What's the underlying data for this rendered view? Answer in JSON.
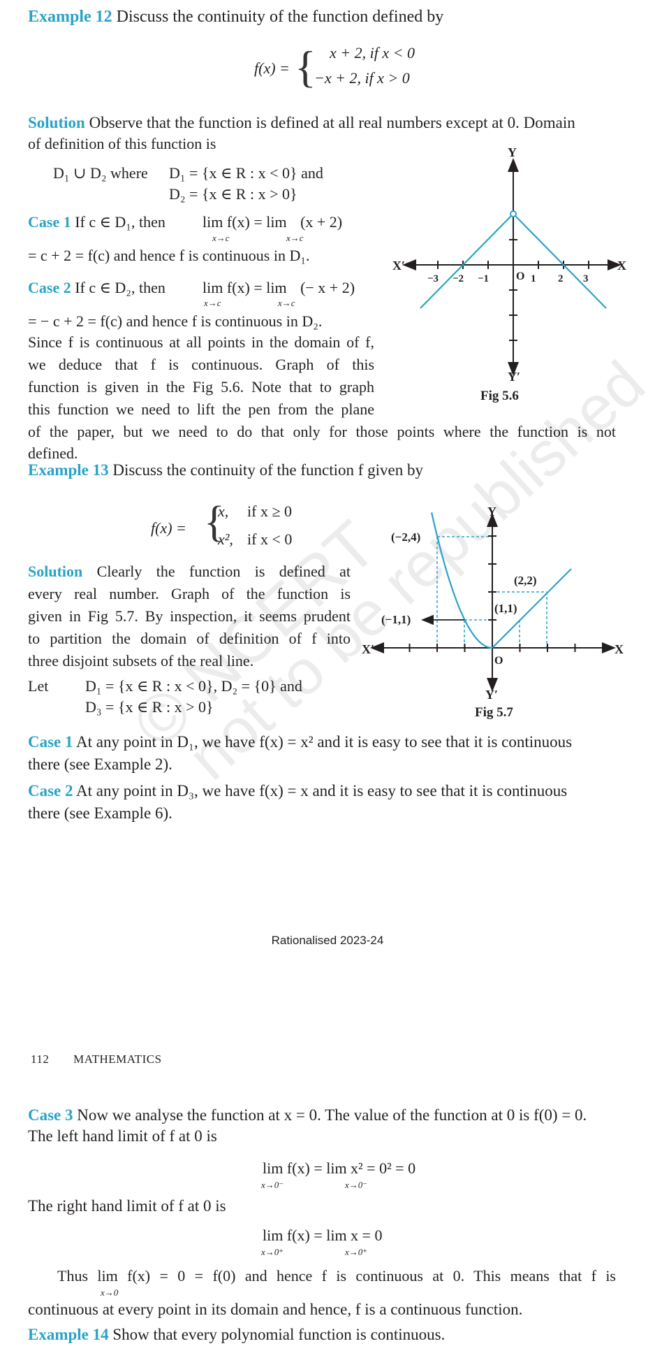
{
  "page": {
    "watermark_line1": "© NCERT",
    "watermark_line2": "not to be republished",
    "footer_center": "Rationalised 2023-24",
    "running_header_page_number": "112",
    "running_header_title": "MATHEMATICS",
    "accent_color": "#2aa3c6",
    "curve_color": "#2aa3c6"
  },
  "example12": {
    "label": "Example 12",
    "prompt": "Discuss the continuity of the function defined by",
    "fx": "f(x) =",
    "case_top": "x + 2, if x < 0",
    "case_bottom": "−x + 2, if x > 0",
    "solution_label": "Solution",
    "solution_line1": "Observe that the function is defined at all real numbers except at 0. Domain",
    "solution_line2": "of definition of this function is",
    "domain_line1_a": "D",
    "domain_union": "D₁ ∪ D₂ where",
    "domain_d1": "D₁ = {x ∈ R : x < 0} and",
    "domain_d2": "D₂ = {x ∈ R : x > 0}",
    "case1_label": "Case 1",
    "case1_text": "If c ∈ D₁, then",
    "case1_lim_left": "lim f(x) = lim",
    "case1_lim_sub": "x→c",
    "case1_expr": "(x + 2)",
    "case1_cont": "= c + 2 = f(c) and hence f is continuous in D₁.",
    "case2_label": "Case 2",
    "case2_text": "If c ∈ D₂, then",
    "case2_expr": "(− x + 2)",
    "case2_cont": "= − c + 2 = f(c) and hence f is continuous in D₂.",
    "para_lines": [
      "Since f is continuous at all points in the domain of f,",
      "we deduce that f is continuous. Graph of this",
      "function is given in the Fig 5.6. Note that to graph",
      "this function we need to lift the pen from the plane"
    ],
    "para_full_line": "of the paper, but we need to do that only for those points where the function is not",
    "para_last": "defined."
  },
  "fig56": {
    "caption": "Fig 5.6",
    "y_label": "Y",
    "y_neg_label": "Y′",
    "x_label": "X",
    "x_neg_label": "X′",
    "origin_label": "O",
    "x_ticks": [
      "−3",
      "−2",
      "−1",
      "1",
      "2",
      "3"
    ]
  },
  "example13": {
    "label": "Example 13",
    "prompt": "Discuss the continuity of the function f given by",
    "fx": "f(x) =",
    "case_top_val": "x,",
    "case_top_cond": "if x ≥ 0",
    "case_bottom_val": "x²,",
    "case_bottom_cond": "if x < 0",
    "solution_label": "Solution",
    "solution_lines": [
      "Clearly the function is defined at",
      "every real number. Graph of the function is",
      "given in Fig 5.7. By inspection, it seems prudent",
      "to partition the domain of definition of f into",
      "three disjoint subsets of the real line."
    ],
    "let_label": "Let",
    "let_line1": "D₁ = {x ∈ R : x < 0}, D₂ = {0} and",
    "let_line2": "D₃ = {x ∈ R : x > 0}",
    "case1_label": "Case 1",
    "case1_text": "At any point in D₁, we have f(x) = x² and it is easy to see that it is continuous",
    "case1_text2": "there (see Example 2).",
    "case2_label": "Case 2",
    "case2_text": "At any point in D₃, we have f(x) = x and it is easy to see that it is continuous",
    "case2_text2": "there (see Example 6).",
    "case3_label": "Case 3",
    "case3_text": "Now we analyse the function at x = 0. The value of the function at 0 is f(0) = 0.",
    "case3_left_intro": "The left hand limit of f at 0 is",
    "left_limit": "lim f(x) = lim x² = 0² = 0",
    "left_limit_sub1": "x→0⁻",
    "left_limit_sub2": "x→0⁻",
    "case3_right_intro": "The right hand limit of f at 0 is",
    "right_limit": "lim f(x) = lim x = 0",
    "right_limit_sub1": "x→0⁺",
    "right_limit_sub2": "x→0⁺",
    "thus_line": "Thus  lim f(x) = 0 = f(0) and hence f is continuous at 0. This means that f is",
    "thus_sub": "x→0",
    "final_line": "continuous at every point in its domain and hence, f is a continuous function."
  },
  "fig57": {
    "caption": "Fig 5.7",
    "y_label": "Y",
    "y_neg_label": "Y′",
    "x_label": "X",
    "x_neg_label": "X′",
    "origin_label": "O",
    "point_labels": [
      "(−2,4)",
      "(−1,1)",
      "(1,1)",
      "(2,2)"
    ]
  },
  "example14": {
    "label": "Example 14",
    "prompt": "Show that every polynomial function is continuous."
  }
}
